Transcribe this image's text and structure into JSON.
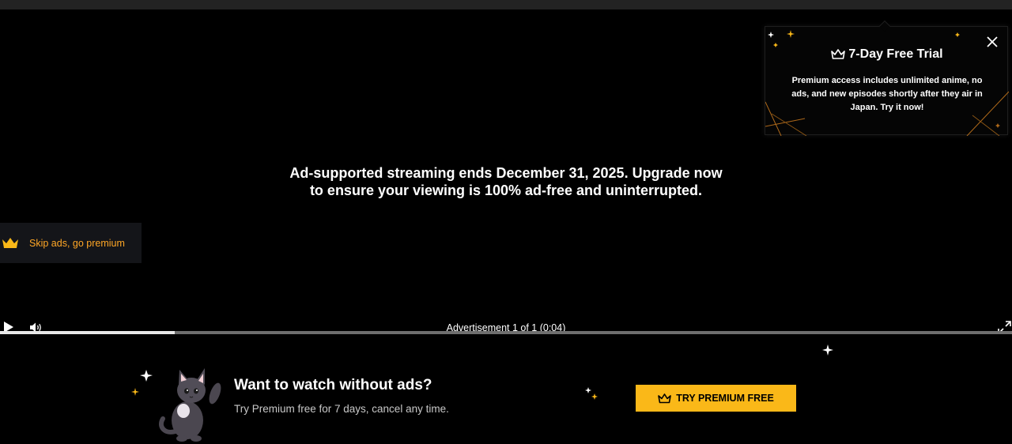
{
  "ad": {
    "message_line1": "Ad-supported streaming ends December 31, 2025. Upgrade now",
    "message_line2": "to ensure your viewing is 100% ad-free and uninterrupted.",
    "skip_label": "Skip ads, go premium",
    "counter": "Advertisement 1 of 1 (0:04)",
    "progress": 0.173
  },
  "trial_popup": {
    "title": "7-Day Free Trial",
    "body": "Premium access includes unlimited anime, no ads, and new episodes shortly after they air in Japan. Try it now!"
  },
  "promo": {
    "title": "Want to watch without ads?",
    "subtitle": "Try Premium free for 7 days, cancel any time.",
    "button_label": "TRY PREMIUM FREE"
  },
  "icons": {
    "play": "play-icon",
    "volume": "volume-icon",
    "fullscreen": "fullscreen-icon",
    "close": "close-icon",
    "crown": "crown-icon"
  },
  "colors": {
    "accent": "#fab818",
    "skip_label": "#ffa726",
    "background": "#000000"
  }
}
